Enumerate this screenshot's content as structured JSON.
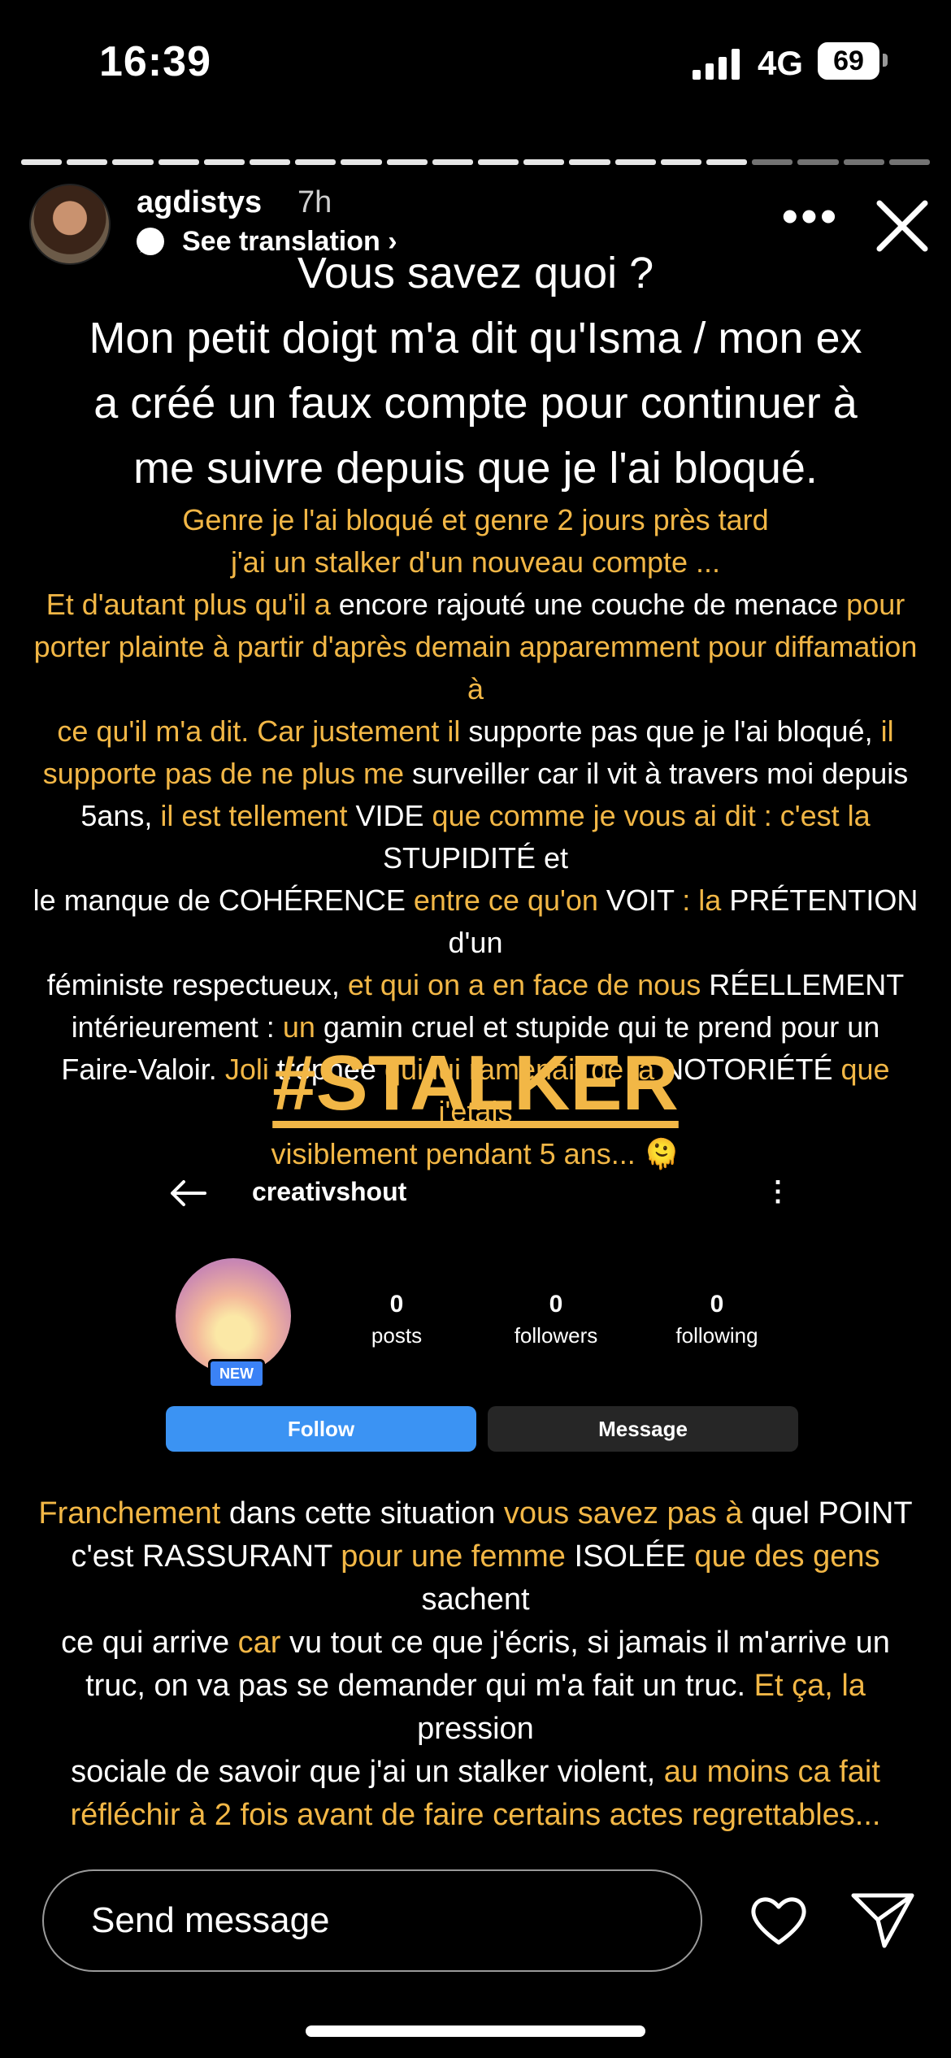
{
  "status_bar": {
    "time": "16:39",
    "network": "4G",
    "battery": "69"
  },
  "story": {
    "username": "agdistys",
    "age": "7h",
    "see_translation": "See translation ›",
    "segments_total": 20,
    "segments_done": 16
  },
  "text": {
    "headline": [
      "Vous savez quoi ?",
      "Mon petit doigt m'a dit qu'Isma / mon ex",
      "a créé un faux compte pour continuer à",
      "me suivre depuis que je l'ai bloqué."
    ],
    "body_lines": [
      [
        {
          "t": "Genre je l'ai bloqué et genre 2 jours près tard",
          "y": true
        }
      ],
      [
        {
          "t": "j'ai un stalker d'un nouveau compte ...",
          "y": true
        }
      ],
      [
        {
          "t": "Et d'autant plus qu'il a ",
          "y": true
        },
        {
          "t": "encore rajouté une couche de menace ",
          "y": false
        },
        {
          "t": "pour",
          "y": true
        }
      ],
      [
        {
          "t": "porter plainte à partir d'après demain apparemment pour diffamation à",
          "y": true
        }
      ],
      [
        {
          "t": "ce qu'il m'a dit. Car justement il ",
          "y": true
        },
        {
          "t": "supporte pas que je l'ai bloqué, ",
          "y": false
        },
        {
          "t": "il",
          "y": true
        }
      ],
      [
        {
          "t": "supporte pas de ne plus me ",
          "y": true
        },
        {
          "t": "surveiller car il vit à travers moi depuis",
          "y": false
        }
      ],
      [
        {
          "t": "5ans, ",
          "y": false
        },
        {
          "t": "il est tellement ",
          "y": true
        },
        {
          "t": "VIDE ",
          "y": false
        },
        {
          "t": "que comme je vous ai dit : c'est la ",
          "y": true
        },
        {
          "t": "STUPIDITÉ et",
          "y": false
        }
      ],
      [
        {
          "t": "le manque de COHÉRENCE ",
          "y": false
        },
        {
          "t": "entre ce qu'on ",
          "y": true
        },
        {
          "t": "VOIT ",
          "y": false
        },
        {
          "t": ": la ",
          "y": true
        },
        {
          "t": "PRÉTENTION d'un",
          "y": false
        }
      ],
      [
        {
          "t": "féministe respectueux, ",
          "y": false
        },
        {
          "t": "et qui on a en face de nous ",
          "y": true
        },
        {
          "t": "RÉELLEMENT",
          "y": false
        }
      ],
      [
        {
          "t": "intérieurement : ",
          "y": false
        },
        {
          "t": "un ",
          "y": true
        },
        {
          "t": "gamin cruel et stupide qui te prend pour un",
          "y": false
        }
      ],
      [
        {
          "t": "Faire-Valoir. ",
          "y": false
        },
        {
          "t": "Joli ",
          "y": true
        },
        {
          "t": "trophée ",
          "y": false
        },
        {
          "t": "qui lui ramenait de la ",
          "y": true
        },
        {
          "t": "NOTORIÉTÉ ",
          "y": false
        },
        {
          "t": "que j'etais",
          "y": true
        }
      ],
      [
        {
          "t": "visiblement pendant 5 ans... 🫠",
          "y": true
        }
      ]
    ],
    "hashtag": "#STALKER",
    "bottom_lines": [
      [
        {
          "t": "Franchement ",
          "y": true
        },
        {
          "t": "dans cette situation ",
          "y": false
        },
        {
          "t": "vous savez pas à ",
          "y": true
        },
        {
          "t": "quel POINT",
          "y": false
        }
      ],
      [
        {
          "t": "c'est RASSURANT ",
          "y": false
        },
        {
          "t": "pour une femme ",
          "y": true
        },
        {
          "t": "ISOLÉE ",
          "y": false
        },
        {
          "t": "que des gens ",
          "y": true
        },
        {
          "t": "sachent",
          "y": false
        }
      ],
      [
        {
          "t": "ce qui arrive ",
          "y": false
        },
        {
          "t": "car ",
          "y": true
        },
        {
          "t": "vu tout ce que j'écris, si jamais il m'arrive un",
          "y": false
        }
      ],
      [
        {
          "t": "truc, on va pas se demander qui m'a fait un truc. ",
          "y": false
        },
        {
          "t": "Et ça, la ",
          "y": true
        },
        {
          "t": "pression",
          "y": false
        }
      ],
      [
        {
          "t": "sociale de savoir que j'ai un stalker violent, ",
          "y": false
        },
        {
          "t": "au moins ca fait",
          "y": true
        }
      ],
      [
        {
          "t": "réfléchir à 2 fois avant de faire certains actes regrettables...",
          "y": true
        }
      ]
    ]
  },
  "embedded_profile": {
    "name": "creativshout",
    "badge": "NEW",
    "stats": [
      {
        "num": "0",
        "label": "posts"
      },
      {
        "num": "0",
        "label": "followers"
      },
      {
        "num": "0",
        "label": "following"
      }
    ],
    "follow": "Follow",
    "message": "Message"
  },
  "reply": {
    "placeholder": "Send message"
  },
  "colors": {
    "accent_yellow": "#f2b746",
    "follow_blue": "#3b93f3"
  }
}
